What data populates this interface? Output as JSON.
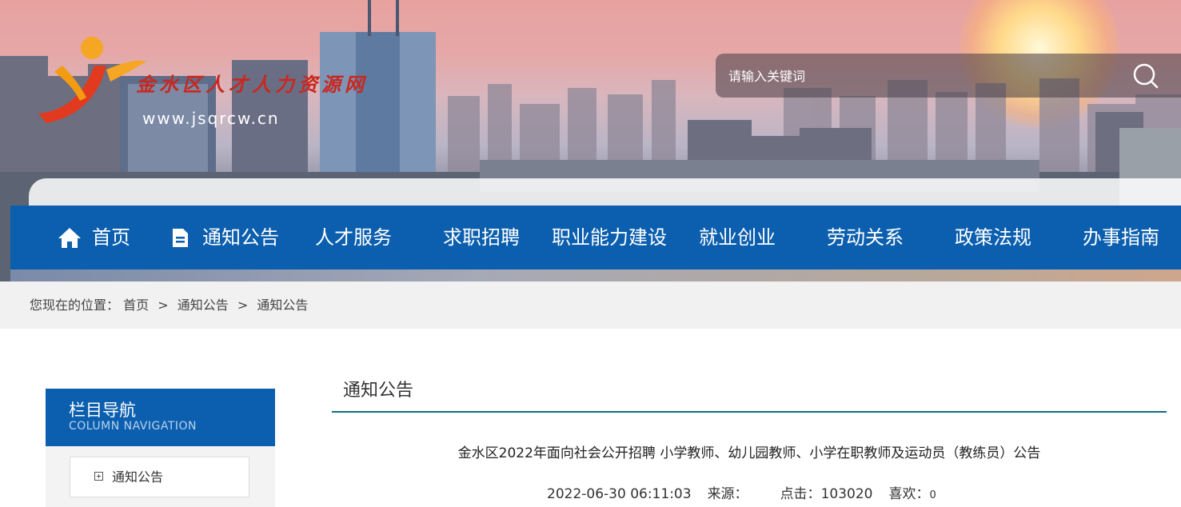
{
  "header": {
    "site_name": "金水区人才人力资源网",
    "site_url": "www.jsqrcw.cn"
  },
  "search": {
    "placeholder": "请输入关键词"
  },
  "nav": {
    "items": [
      {
        "label": "首页",
        "icon": "home-icon"
      },
      {
        "label": "通知公告",
        "icon": "document-icon"
      },
      {
        "label": "人才服务"
      },
      {
        "label": "求职招聘"
      },
      {
        "label": "职业能力建设"
      },
      {
        "label": "就业创业"
      },
      {
        "label": "劳动关系"
      },
      {
        "label": "政策法规"
      },
      {
        "label": "办事指南"
      }
    ]
  },
  "breadcrumb": {
    "prefix": "您现在的位置：",
    "items": [
      "首页",
      "通知公告",
      "通知公告"
    ],
    "separator": ">"
  },
  "sidebar": {
    "title": "栏目导航",
    "subtitle": "COLUMN NAVIGATION",
    "items": [
      {
        "label": "通知公告"
      }
    ]
  },
  "content": {
    "section_title": "通知公告",
    "article_title": "金水区2022年面向社会公开招聘 小学教师、幼儿园教师、小学在职教师及运动员（教练员）公告",
    "date": "2022-06-30 06:11:03",
    "source_label": "来源：",
    "source_value": "",
    "clicks_label": "点击：",
    "clicks_value": "103020",
    "likes_label": "喜欢：",
    "likes_value": "0"
  },
  "colors": {
    "nav_blue": "#0c5fae",
    "rule_teal": "#0f6f7a",
    "breadcrumb_bg": "#f1f1f1"
  }
}
